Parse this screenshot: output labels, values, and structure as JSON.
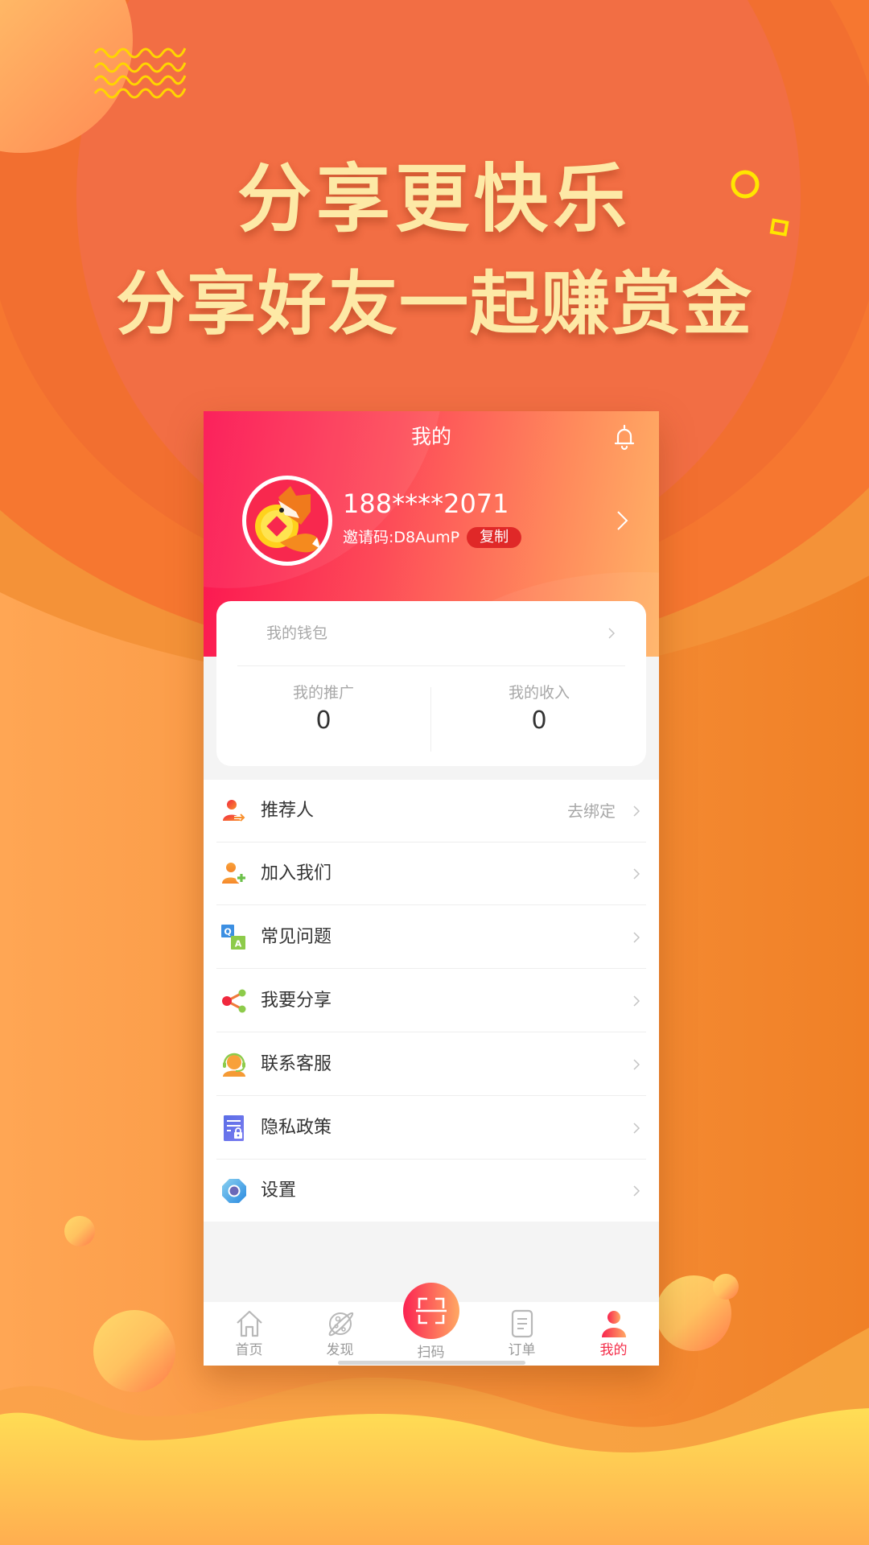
{
  "banner": {
    "line1": "分享更快乐",
    "line2": "分享好友一起赚赏金"
  },
  "colors": {
    "accent_red": "#f42e4a",
    "header_gradient_start": "#fb1150",
    "header_gradient_end": "#ffb466",
    "copy_badge": "#e02828",
    "decor_yellow": "#ffe600"
  },
  "app": {
    "title": "我的",
    "bell_icon": "bell-icon"
  },
  "profile": {
    "phone": "188****2071",
    "invite_label": "邀请码:",
    "invite_code": "D8AumP",
    "copy_label": "复制"
  },
  "wallet": {
    "label": "我的钱包",
    "stats": [
      {
        "label": "我的推广",
        "value": "0"
      },
      {
        "label": "我的收入",
        "value": "0"
      }
    ]
  },
  "menu": [
    {
      "label": "推荐人",
      "extra": "去绑定",
      "icon": "referrer-icon"
    },
    {
      "label": "加入我们",
      "extra": "",
      "icon": "add-user-icon"
    },
    {
      "label": "常见问题",
      "extra": "",
      "icon": "qa-icon"
    },
    {
      "label": "我要分享",
      "extra": "",
      "icon": "share-icon"
    },
    {
      "label": "联系客服",
      "extra": "",
      "icon": "customer-service-icon"
    },
    {
      "label": "隐私政策",
      "extra": "",
      "icon": "privacy-policy-icon"
    },
    {
      "label": "设置",
      "extra": "",
      "icon": "settings-icon"
    }
  ],
  "tabbar": {
    "tabs": [
      {
        "label": "首页",
        "icon": "home-icon",
        "active": false
      },
      {
        "label": "发现",
        "icon": "planet-icon",
        "active": false
      },
      {
        "label": "扫码",
        "icon": "scan-icon",
        "active": false
      },
      {
        "label": "订单",
        "icon": "order-icon",
        "active": false
      },
      {
        "label": "我的",
        "icon": "user-icon",
        "active": true
      }
    ]
  }
}
